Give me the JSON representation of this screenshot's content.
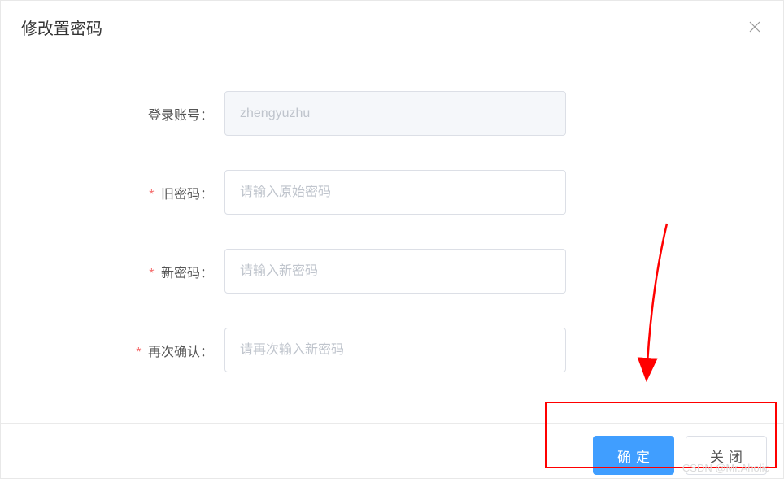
{
  "dialog": {
    "title": "修改置密码"
  },
  "form": {
    "account": {
      "label": "登录账号：",
      "value": "zhengyuzhu"
    },
    "oldPassword": {
      "label": "旧密码：",
      "placeholder": "请输入原始密码",
      "required": "*"
    },
    "newPassword": {
      "label": "新密码：",
      "placeholder": "请输入新密码",
      "required": "*"
    },
    "confirmPassword": {
      "label": "再次确认：",
      "placeholder": "请再次输入新密码",
      "required": "*"
    }
  },
  "buttons": {
    "confirm": "确定",
    "close": "关闭"
  },
  "watermark": "CSDN @Mr.Aholic"
}
